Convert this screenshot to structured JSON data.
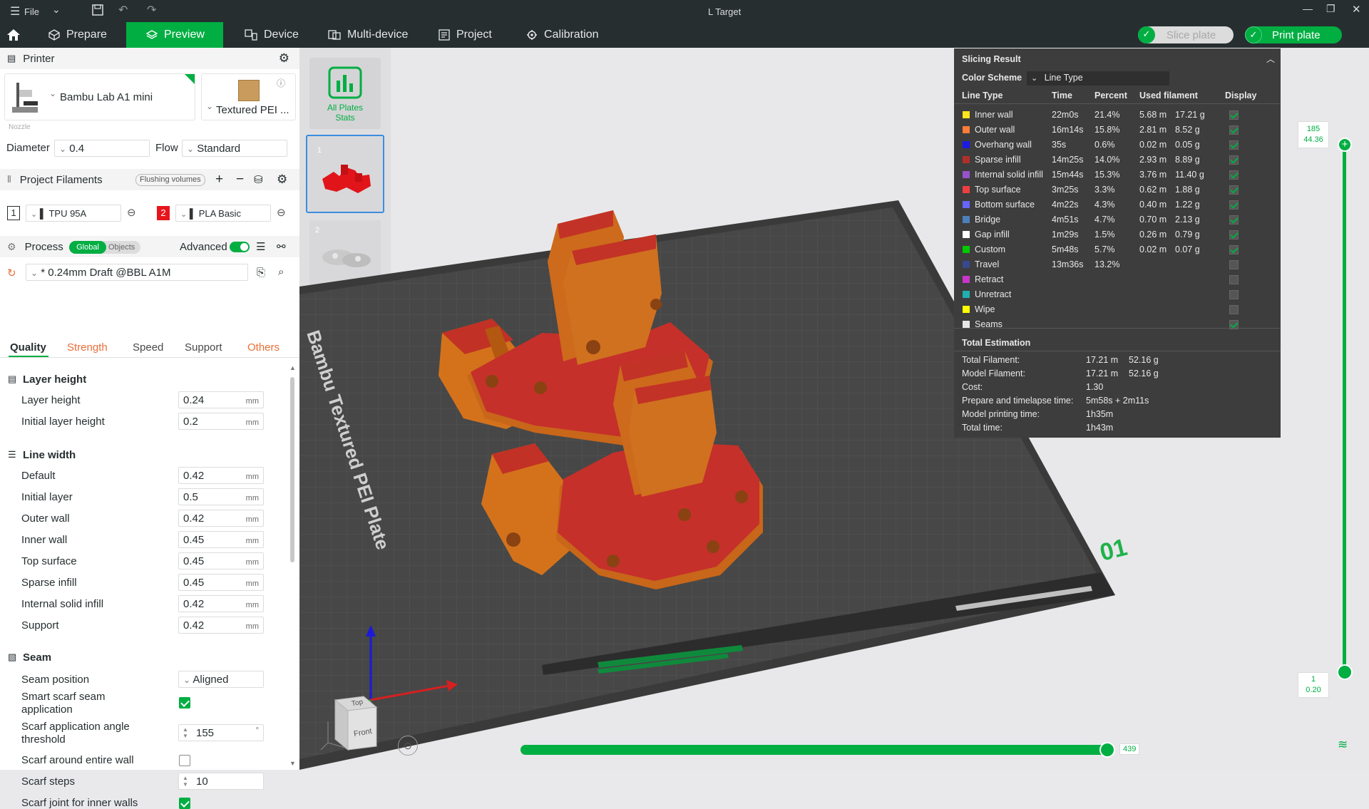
{
  "window": {
    "title": "L Target",
    "file_menu": "File"
  },
  "nav": {
    "prepare": "Prepare",
    "preview": "Preview",
    "device": "Device",
    "multi_device": "Multi-device",
    "project": "Project",
    "calibration": "Calibration",
    "slice_plate": "Slice plate",
    "print_plate": "Print plate"
  },
  "printer": {
    "section_title": "Printer",
    "name": "Bambu Lab A1 mini",
    "plate": "Textured PEI ...",
    "nozzle_label": "Nozzle",
    "diameter_label": "Diameter",
    "diameter_value": "0.4",
    "flow_label": "Flow",
    "flow_value": "Standard"
  },
  "filaments": {
    "section_title": "Project Filaments",
    "flushing_button": "Flushing volumes",
    "items": [
      {
        "index": "1",
        "name": "TPU 95A",
        "color": "#1a1a1a"
      },
      {
        "index": "2",
        "name": "PLA Basic",
        "color": "#e8141c"
      }
    ]
  },
  "process": {
    "section_title": "Process",
    "global_label": "Global",
    "objects_label": "Objects",
    "advanced_label": "Advanced",
    "preset": "* 0.24mm Draft @BBL A1M",
    "tabs": [
      "Quality",
      "Strength",
      "Speed",
      "Support",
      "Others"
    ]
  },
  "settings": {
    "layer_height_group": "Layer height",
    "layer_height_label": "Layer height",
    "layer_height_value": "0.24",
    "initial_layer_height_label": "Initial layer height",
    "initial_layer_height_value": "0.2",
    "line_width_group": "Line width",
    "default_label": "Default",
    "default_value": "0.42",
    "initial_layer_label": "Initial layer",
    "initial_layer_value": "0.5",
    "outer_wall_label": "Outer wall",
    "outer_wall_value": "0.42",
    "inner_wall_label": "Inner wall",
    "inner_wall_value": "0.45",
    "top_surface_label": "Top surface",
    "top_surface_value": "0.45",
    "sparse_infill_label": "Sparse infill",
    "sparse_infill_value": "0.45",
    "internal_solid_infill_label": "Internal solid infill",
    "internal_solid_infill_value": "0.42",
    "support_label": "Support",
    "support_value": "0.42",
    "unit": "mm",
    "seam_group": "Seam",
    "seam_position_label": "Seam position",
    "seam_position_value": "Aligned",
    "smart_scarf_label_1": "Smart scarf seam",
    "smart_scarf_label_2": "application",
    "scarf_angle_label_1": "Scarf application angle",
    "scarf_angle_label_2": "threshold",
    "scarf_angle_value": "155",
    "scarf_angle_unit": "°",
    "scarf_entire_wall_label": "Scarf around entire wall",
    "scarf_steps_label": "Scarf steps",
    "scarf_steps_value": "10",
    "scarf_inner_walls_label": "Scarf joint for inner walls"
  },
  "plates": {
    "all_plates_label_1": "All Plates",
    "all_plates_label_2": "Stats",
    "plate1": "1",
    "plate2": "2"
  },
  "bed": {
    "label": "Bambu Textured PEI Plate",
    "plate_number": "01"
  },
  "slicing_result": {
    "title": "Slicing Result",
    "color_scheme_label": "Color Scheme",
    "color_scheme_value": "Line Type",
    "headers": [
      "Line Type",
      "Time",
      "Percent",
      "Used filament",
      "Display"
    ],
    "rows": [
      {
        "name": "Inner wall",
        "color": "#ffe51c",
        "time": "22m0s",
        "percent": "21.4%",
        "len": "5.68 m",
        "weight": "17.21 g",
        "display": true
      },
      {
        "name": "Outer wall",
        "color": "#ff7d38",
        "time": "16m14s",
        "percent": "15.8%",
        "len": "2.81 m",
        "weight": "8.52 g",
        "display": true
      },
      {
        "name": "Overhang wall",
        "color": "#1c19e8",
        "time": "35s",
        "percent": "0.6%",
        "len": "0.02 m",
        "weight": "0.05 g",
        "display": true
      },
      {
        "name": "Sparse infill",
        "color": "#b03029",
        "time": "14m25s",
        "percent": "14.0%",
        "len": "2.93 m",
        "weight": "8.89 g",
        "display": true
      },
      {
        "name": "Internal solid infill",
        "color": "#9654cc",
        "time": "15m44s",
        "percent": "15.3%",
        "len": "3.76 m",
        "weight": "11.40 g",
        "display": true
      },
      {
        "name": "Top surface",
        "color": "#f03e3e",
        "time": "3m25s",
        "percent": "3.3%",
        "len": "0.62 m",
        "weight": "1.88 g",
        "display": true
      },
      {
        "name": "Bottom surface",
        "color": "#6666ff",
        "time": "4m22s",
        "percent": "4.3%",
        "len": "0.40 m",
        "weight": "1.22 g",
        "display": true
      },
      {
        "name": "Bridge",
        "color": "#4d80ba",
        "time": "4m51s",
        "percent": "4.7%",
        "len": "0.70 m",
        "weight": "2.13 g",
        "display": true
      },
      {
        "name": "Gap infill",
        "color": "#ffffff",
        "time": "1m29s",
        "percent": "1.5%",
        "len": "0.26 m",
        "weight": "0.79 g",
        "display": true
      },
      {
        "name": "Custom",
        "color": "#00c900",
        "time": "5m48s",
        "percent": "5.7%",
        "len": "0.02 m",
        "weight": "0.07 g",
        "display": true
      },
      {
        "name": "Travel",
        "color": "#38488f",
        "time": "13m36s",
        "percent": "13.2%",
        "len": "",
        "weight": "",
        "display": false
      },
      {
        "name": "Retract",
        "color": "#c936c9",
        "time": "",
        "percent": "",
        "len": "",
        "weight": "",
        "display": false
      },
      {
        "name": "Unretract",
        "color": "#1fb0b0",
        "time": "",
        "percent": "",
        "len": "",
        "weight": "",
        "display": false
      },
      {
        "name": "Wipe",
        "color": "#ffff00",
        "time": "",
        "percent": "",
        "len": "",
        "weight": "",
        "display": false
      },
      {
        "name": "Seams",
        "color": "#e6e6e6",
        "time": "",
        "percent": "",
        "len": "",
        "weight": "",
        "display": true
      }
    ],
    "total_title": "Total Estimation",
    "totals": [
      {
        "label": "Total Filament:",
        "value": "17.21 m",
        "value2": "52.16 g"
      },
      {
        "label": "Model Filament:",
        "value": "17.21 m",
        "value2": "52.16 g"
      },
      {
        "label": "Cost:",
        "value": "1.30",
        "value2": ""
      },
      {
        "label": "Prepare and timelapse time:",
        "value": "5m58s + 2m11s",
        "value2": ""
      },
      {
        "label": "Model printing time:",
        "value": "1h35m",
        "value2": ""
      },
      {
        "label": "Total time:",
        "value": "1h43m",
        "value2": ""
      }
    ]
  },
  "layer_slider": {
    "top_layer": "185",
    "top_height": "44.36",
    "bottom_layer": "1",
    "bottom_height": "0.20"
  },
  "move_slider": {
    "value": "439"
  },
  "orientation_cube": {
    "top": "Top",
    "front": "Front"
  }
}
